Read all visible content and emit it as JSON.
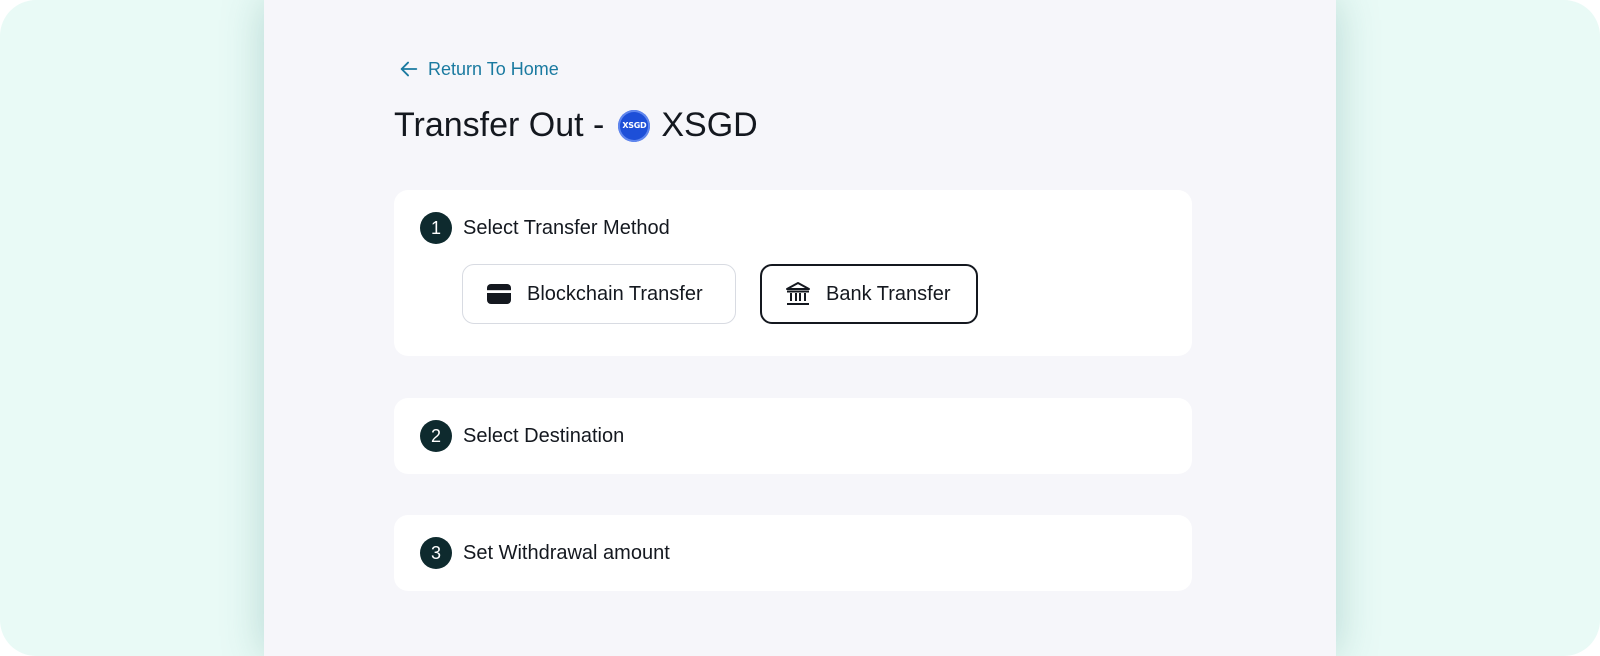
{
  "header": {
    "back_label": "Return To Home",
    "title_prefix": "Transfer Out -",
    "coin_badge": "XSGD",
    "coin_name": "XSGD"
  },
  "steps": [
    {
      "number": "1",
      "title": "Select Transfer Method",
      "options": [
        {
          "label": "Blockchain Transfer",
          "icon": "wallet-icon",
          "selected": false
        },
        {
          "label": "Bank Transfer",
          "icon": "bank-icon",
          "selected": true
        }
      ]
    },
    {
      "number": "2",
      "title": "Select Destination"
    },
    {
      "number": "3",
      "title": "Set Withdrawal amount"
    }
  ],
  "colors": {
    "frame_bg": "#e9faf6",
    "panel_bg": "#f6f6fa",
    "link": "#1a7aa0",
    "step_badge": "#0e2a2e",
    "coin": "#1d4fd8"
  }
}
